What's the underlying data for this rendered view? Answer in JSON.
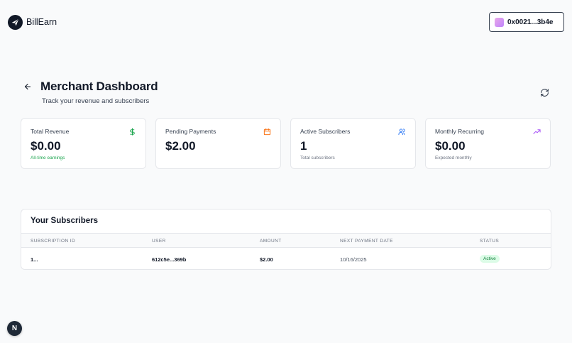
{
  "header": {
    "brand_name": "BillEarn",
    "wallet_address": "0x0021...3b4e"
  },
  "page": {
    "title": "Merchant Dashboard",
    "subtitle": "Track your revenue and subscribers"
  },
  "cards": [
    {
      "label": "Total Revenue",
      "value": "$0.00",
      "sub": "All-time earnings",
      "icon": "dollar-icon",
      "icon_color": "#16a34a"
    },
    {
      "label": "Pending Payments",
      "value": "$2.00",
      "sub": "",
      "icon": "calendar-icon",
      "icon_color": "#f97316"
    },
    {
      "label": "Active Subscribers",
      "value": "1",
      "sub": "Total subscribers",
      "icon": "users-icon",
      "icon_color": "#3b82f6"
    },
    {
      "label": "Monthly Recurring",
      "value": "$0.00",
      "sub": "Expected monthly",
      "icon": "trending-up-icon",
      "icon_color": "#a855f7"
    }
  ],
  "subscribers": {
    "title": "Your Subscribers",
    "columns": [
      "SUBSCRIPTION ID",
      "USER",
      "AMOUNT",
      "NEXT PAYMENT DATE",
      "STATUS"
    ],
    "rows": [
      {
        "id": "1...",
        "user": "612c5e...369b",
        "amount": "$2.00",
        "next_payment": "10/16/2025",
        "status": "Active"
      }
    ]
  },
  "badge": {
    "letter": "N"
  }
}
